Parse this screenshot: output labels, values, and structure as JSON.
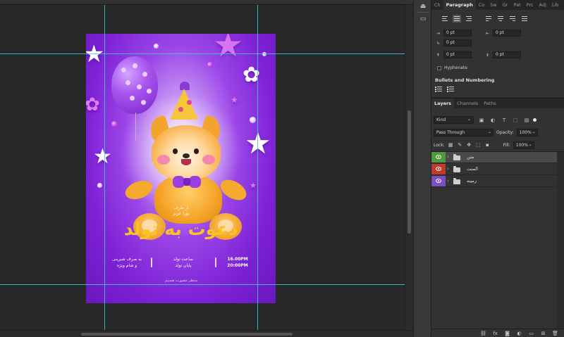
{
  "panels": {
    "paragraph_tabs": [
      "Ch",
      "Paragraph",
      "Co",
      "Sw",
      "Gr",
      "Pat",
      "Prc",
      "Adj",
      "Lib"
    ],
    "layers_tabs": [
      "Layers",
      "Channels",
      "Paths"
    ]
  },
  "paragraph": {
    "indent_left": "0 pt",
    "indent_right": "0 pt",
    "indent_first": "0 pt",
    "space_before": "0 pt",
    "space_after": "0 pt",
    "hyphenate_label": "Hyphenate",
    "bullets_label": "Bullets and Numbering"
  },
  "layers": {
    "filter_kind": "Kind",
    "blend_mode": "Pass Through",
    "opacity_label": "Opacity:",
    "opacity_value": "100%",
    "lock_label": "Lock:",
    "fill_label": "Fill:",
    "fill_value": "100%",
    "items": [
      {
        "name": "متن",
        "color": "#4f9a3b"
      },
      {
        "name": "المنت",
        "color": "#c0392b"
      },
      {
        "name": "زمینه",
        "color": "#7a4fc0"
      }
    ]
  },
  "poster": {
    "from_line1": "از طرف",
    "from_line2": "نورا عزیز",
    "headline": "دعوت به تولد",
    "times": [
      "16.00PM",
      "20:00PM"
    ],
    "time_labels": [
      "ساعت تولد",
      "پایان تولد"
    ],
    "notes": [
      "به صرف شیرینی",
      "و شام ویژه"
    ],
    "footer": "منتظر حضورت هستیم",
    "accent_color": "#fbc228"
  }
}
